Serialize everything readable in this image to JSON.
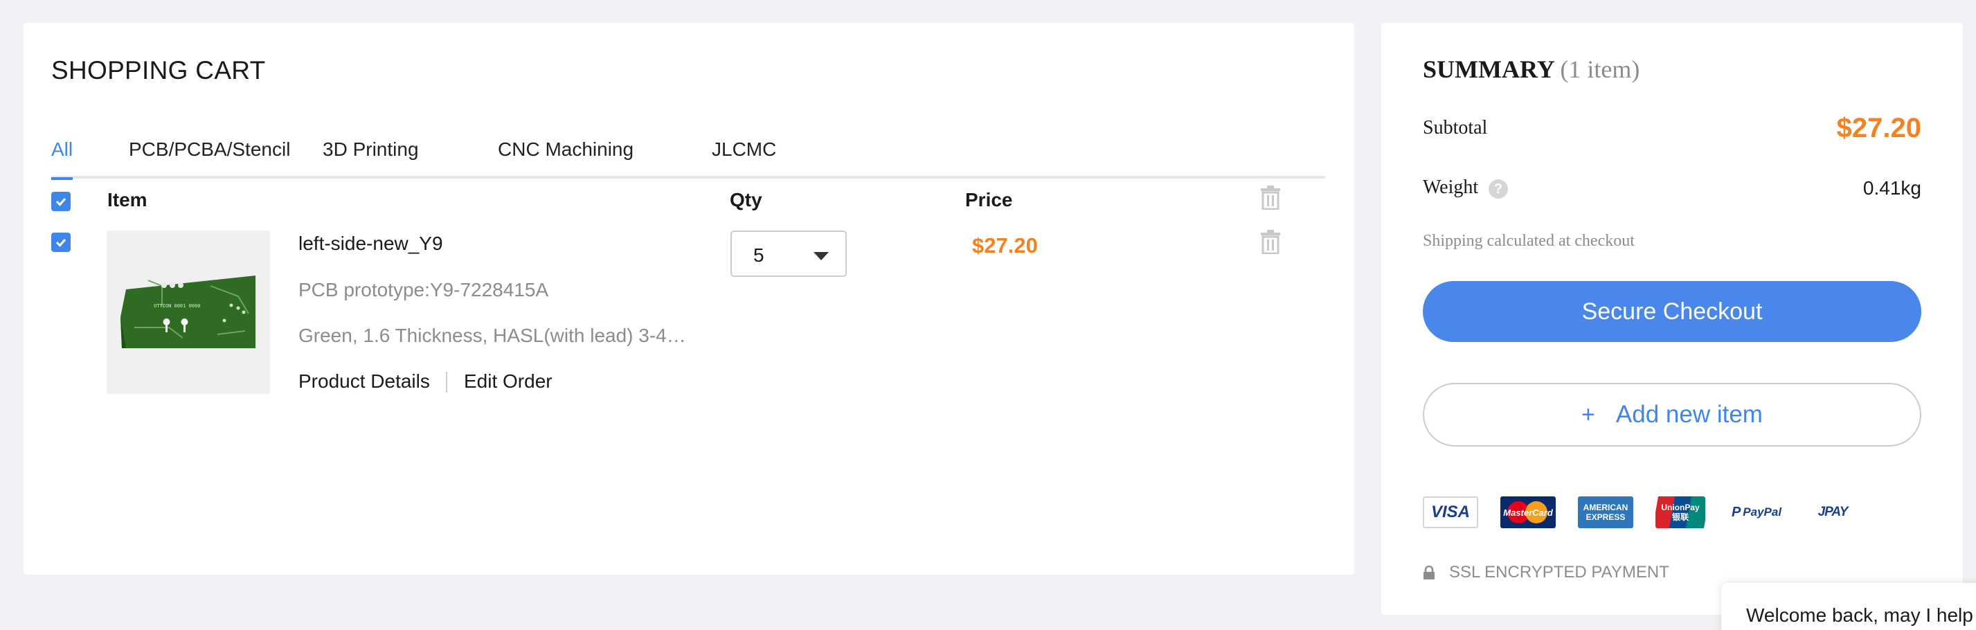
{
  "cart": {
    "title": "SHOPPING CART",
    "tabs": [
      "All",
      "PCB/PCBA/Stencil",
      "3D Printing",
      "CNC Machining",
      "JLCMC"
    ],
    "active_tab": "All",
    "headers": {
      "item": "Item",
      "qty": "Qty",
      "price": "Price"
    },
    "items": [
      {
        "name": "left-side-new_Y9",
        "subtitle": "PCB prototype:Y9-7228415A",
        "specs": "Green, 1.6 Thickness, HASL(with lead) 3-4…",
        "qty": "5",
        "price": "$27.20",
        "selected": true,
        "actions": {
          "details": "Product Details",
          "edit": "Edit Order"
        },
        "board_text": "OTTION 0001 0000"
      }
    ]
  },
  "summary": {
    "title": "SUMMARY",
    "count": "(1 item)",
    "subtotal_label": "Subtotal",
    "subtotal": "$27.20",
    "weight_label": "Weight",
    "weight_help": "?",
    "weight": "0.41kg",
    "shipping_note": "Shipping calculated at checkout",
    "checkout": "Secure Checkout",
    "add_plus": "+",
    "add_item": "Add new item",
    "payments": {
      "visa": "VISA",
      "mastercard": "MasterCard",
      "amex_1": "AMERICAN",
      "amex_2": "EXPRESS",
      "unionpay": "UnionPay",
      "unionpay_cn": "银联",
      "paypal": "PayPal",
      "jpay": "JPAY"
    },
    "ssl": "SSL ENCRYPTED PAYMENT"
  },
  "chat": {
    "message": "Welcome back, may I help y"
  },
  "colors": {
    "accent": "#3f86ea",
    "price": "#f5821f",
    "button": "#4a87ea",
    "pcb_green": "#2f6b22"
  }
}
